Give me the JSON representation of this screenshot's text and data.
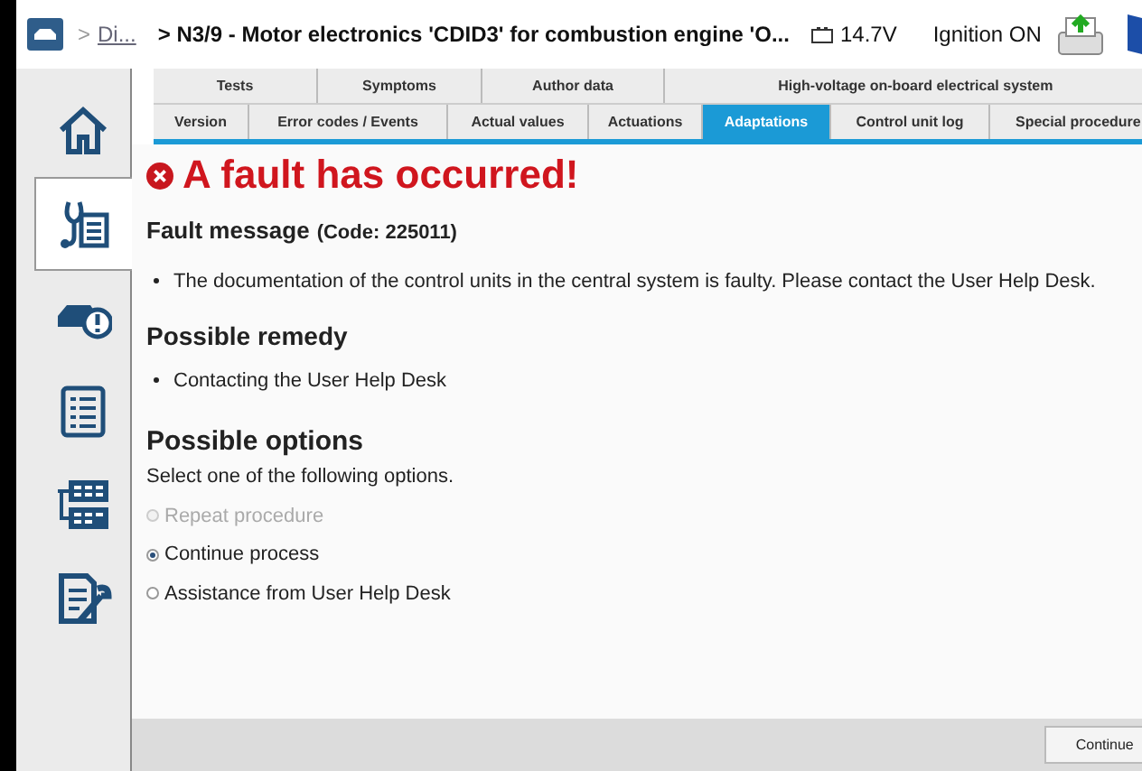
{
  "header": {
    "breadcrumb_link": "Di...",
    "separator": ">",
    "title": "> N3/9 - Motor electronics 'CDID3' for combustion engine 'O...",
    "voltage": "14.7V",
    "ignition": "Ignition ON"
  },
  "sidebar": {
    "items": [
      {
        "selected": false
      },
      {
        "selected": true
      },
      {
        "selected": false
      },
      {
        "selected": false
      },
      {
        "selected": false
      },
      {
        "selected": false
      }
    ]
  },
  "tabs_top": [
    {
      "label": "Tests"
    },
    {
      "label": "Symptoms"
    },
    {
      "label": "Author data"
    },
    {
      "label": "High-voltage on-board electrical system"
    }
  ],
  "tabs": [
    {
      "label": "Version",
      "selected": false
    },
    {
      "label": "Error codes / Events",
      "selected": false
    },
    {
      "label": "Actual values",
      "selected": false
    },
    {
      "label": "Actuations",
      "selected": false
    },
    {
      "label": "Adaptations",
      "selected": true
    },
    {
      "label": "Control unit log",
      "selected": false
    },
    {
      "label": "Special procedure",
      "selected": false
    }
  ],
  "error_title": "A fault has occurred!",
  "fault": {
    "heading": "Fault message",
    "code": "(Code: 225011)",
    "items": [
      "The documentation of the control units in the central system is faulty. Please contact the User Help Desk."
    ]
  },
  "remedy": {
    "heading": "Possible remedy",
    "items": [
      "Contacting the User Help Desk"
    ]
  },
  "options": {
    "heading": "Possible options",
    "instruction": "Select one of the following options.",
    "items": [
      {
        "label": "Repeat procedure",
        "selected": false,
        "disabled": true
      },
      {
        "label": "Continue process",
        "selected": true,
        "disabled": false
      },
      {
        "label": "Assistance from User Help Desk",
        "selected": false,
        "disabled": false
      }
    ]
  },
  "footer": {
    "button": "Continue"
  }
}
